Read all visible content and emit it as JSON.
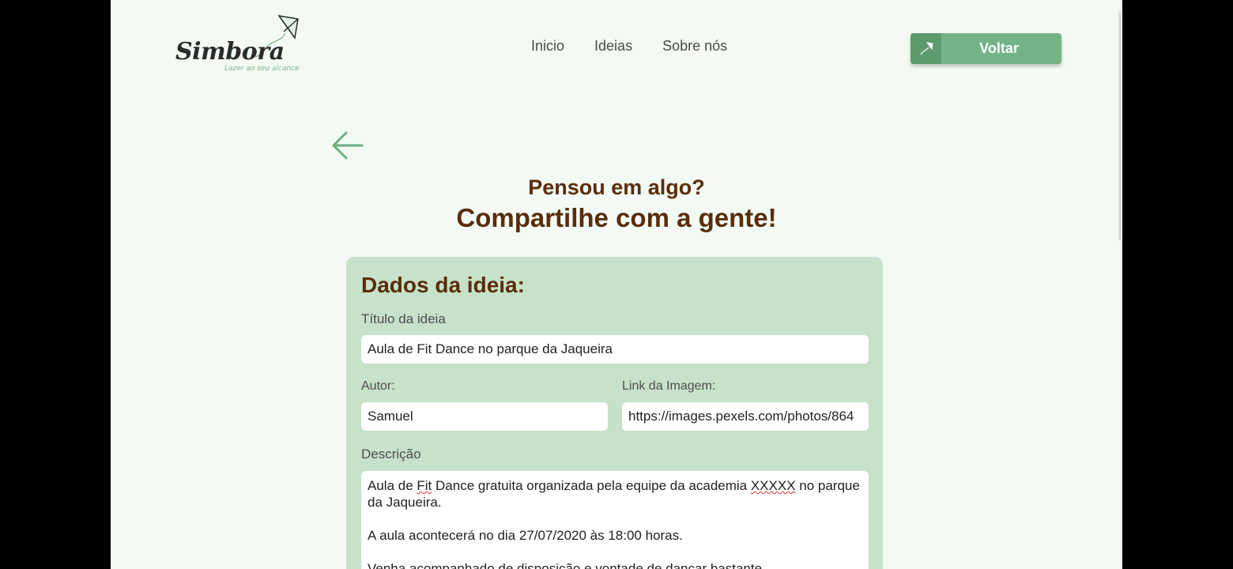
{
  "brand": {
    "name": "Simbora",
    "tagline": "Lazer ao seu alcance"
  },
  "nav": {
    "items": [
      {
        "label": "Inicio"
      },
      {
        "label": "Ideias"
      },
      {
        "label": "Sobre nós"
      }
    ]
  },
  "header": {
    "voltar_label": "Voltar"
  },
  "page": {
    "heading_1": "Pensou em algo?",
    "heading_2": "Compartilhe com a gente!"
  },
  "form": {
    "title": "Dados da ideia:",
    "titulo_label": "Título da ideia",
    "titulo_value": "Aula de Fit Dance no parque da Jaqueira",
    "autor_label": "Autor:",
    "autor_value": "Samuel",
    "imagem_label": "Link da Imagem:",
    "imagem_value": "https://images.pexels.com/photos/864",
    "descricao_label": "Descrição",
    "descricao": {
      "p1_a": "Aula de ",
      "p1_b": "Fit",
      "p1_c": " Dance gratuita organizada pela equipe da academia ",
      "p1_d": "XXXXX",
      "p1_e": " no parque da Jaqueira.",
      "p2": "A aula acontecerá no dia 27/07/2020 às 18:00 horas.",
      "p3": "Venha acompanhado de disposição e vontade de dançar bastante."
    }
  },
  "colors": {
    "background": "#f2faf3",
    "accent_green": "#74b387",
    "card_green": "#c7e2c9",
    "heading_brown": "#5a2d0c"
  },
  "icons": {
    "back": "arrow-left-icon",
    "voltar": "kite-icon",
    "logo": "kite-logo-icon"
  }
}
